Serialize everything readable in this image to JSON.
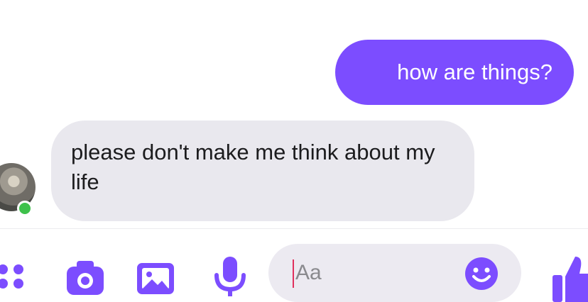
{
  "conversation": {
    "messages": [
      {
        "direction": "outgoing",
        "text": "how are things?"
      },
      {
        "direction": "incoming",
        "text": "please don't make me think about my life"
      }
    ],
    "contact": {
      "status": "online"
    }
  },
  "composer": {
    "placeholder": "Aa"
  },
  "icons": {
    "more": "more-icon",
    "camera": "camera-icon",
    "gallery": "image-icon",
    "mic": "microphone-icon",
    "emoji": "emoji-icon",
    "like": "thumbs-up-icon"
  },
  "colors": {
    "accent": "#7c4dff",
    "incoming_bubble": "#e9e8ee",
    "online": "#3ec14b"
  }
}
